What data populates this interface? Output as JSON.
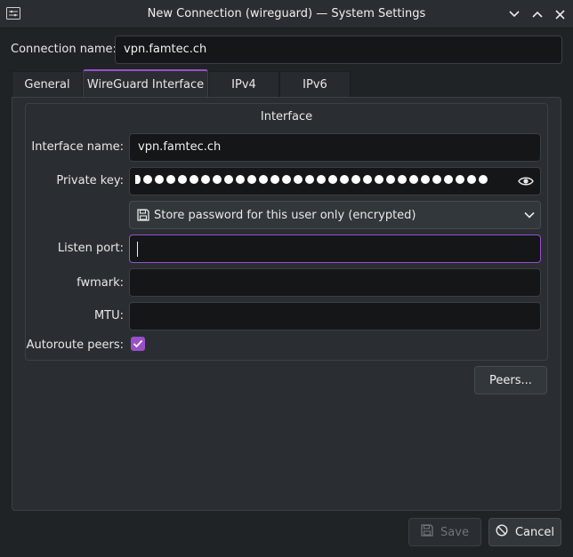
{
  "window": {
    "title": "New Connection (wireguard) — System Settings",
    "icons": {
      "app": "settings-app-icon",
      "minimize": "chevron-down-icon",
      "maximize": "chevron-up-icon",
      "close": "close-icon"
    }
  },
  "connection": {
    "label": "Connection name:",
    "value": "vpn.famtec.ch"
  },
  "tabs": [
    {
      "label": "General",
      "active": false
    },
    {
      "label": "WireGuard Interface",
      "active": true
    },
    {
      "label": "IPv4",
      "active": false
    },
    {
      "label": "IPv6",
      "active": false
    }
  ],
  "interface": {
    "group_title": "Interface",
    "interface_name": {
      "label": "Interface name:",
      "value": "vpn.famtec.ch"
    },
    "private_key": {
      "label": "Private key:",
      "masked_count": 31,
      "reveal_icon": "eye-icon"
    },
    "password_storage": {
      "selected": "Store password for this user only (encrypted)",
      "icon": "floppy-disk-icon"
    },
    "listen_port": {
      "label": "Listen port:",
      "value": ""
    },
    "fwmark": {
      "label": "fwmark:",
      "value": ""
    },
    "mtu": {
      "label": "MTU:",
      "value": ""
    },
    "autoroute_peers": {
      "label": "Autoroute peers:",
      "checked": true
    }
  },
  "buttons": {
    "peers": "Peers...",
    "save": "Save",
    "cancel": "Cancel"
  },
  "colors": {
    "accent": "#9a4fc9",
    "background": "#202326",
    "panel": "#2a2e32",
    "field": "#141618"
  }
}
